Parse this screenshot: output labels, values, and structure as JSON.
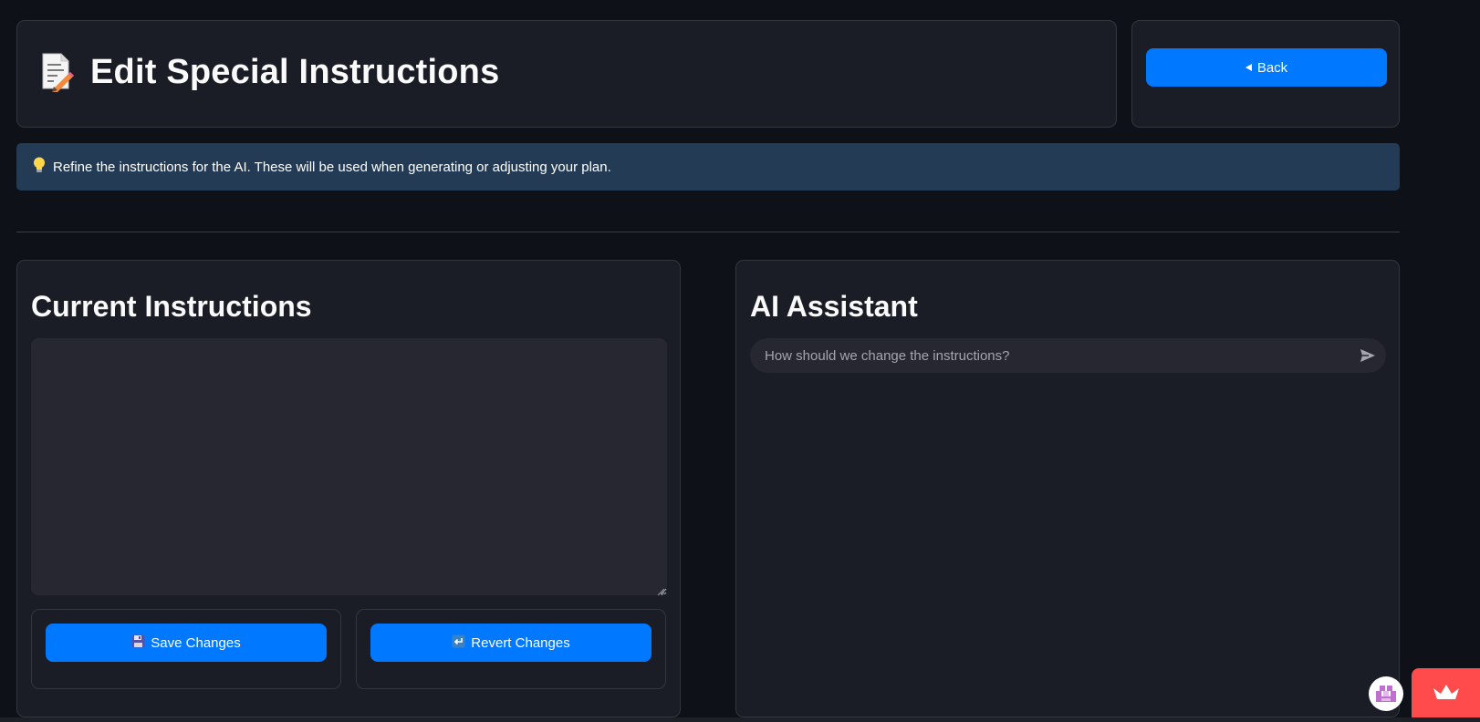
{
  "header": {
    "title": "Edit Special Instructions",
    "icon": "memo-pencil-icon"
  },
  "nav": {
    "back_label": "Back"
  },
  "info": {
    "icon": "lightbulb-icon",
    "text": "Refine the instructions for the AI. These will be used when generating or adjusting your plan."
  },
  "instructions": {
    "title": "Current Instructions",
    "value": "",
    "save_label": "Save Changes",
    "save_icon": "floppy-disk-icon",
    "revert_label": "Revert Changes",
    "revert_icon": "return-arrow-icon"
  },
  "assistant": {
    "title": "AI Assistant",
    "placeholder": "How should we change the instructions?",
    "send_icon": "send-icon"
  },
  "colors": {
    "background": "#0e1117",
    "card": "#1a1d25",
    "primary_button": "#0078ff",
    "info_bar": "#243b55",
    "input": "#262730",
    "badge": "#ff4b4b"
  }
}
